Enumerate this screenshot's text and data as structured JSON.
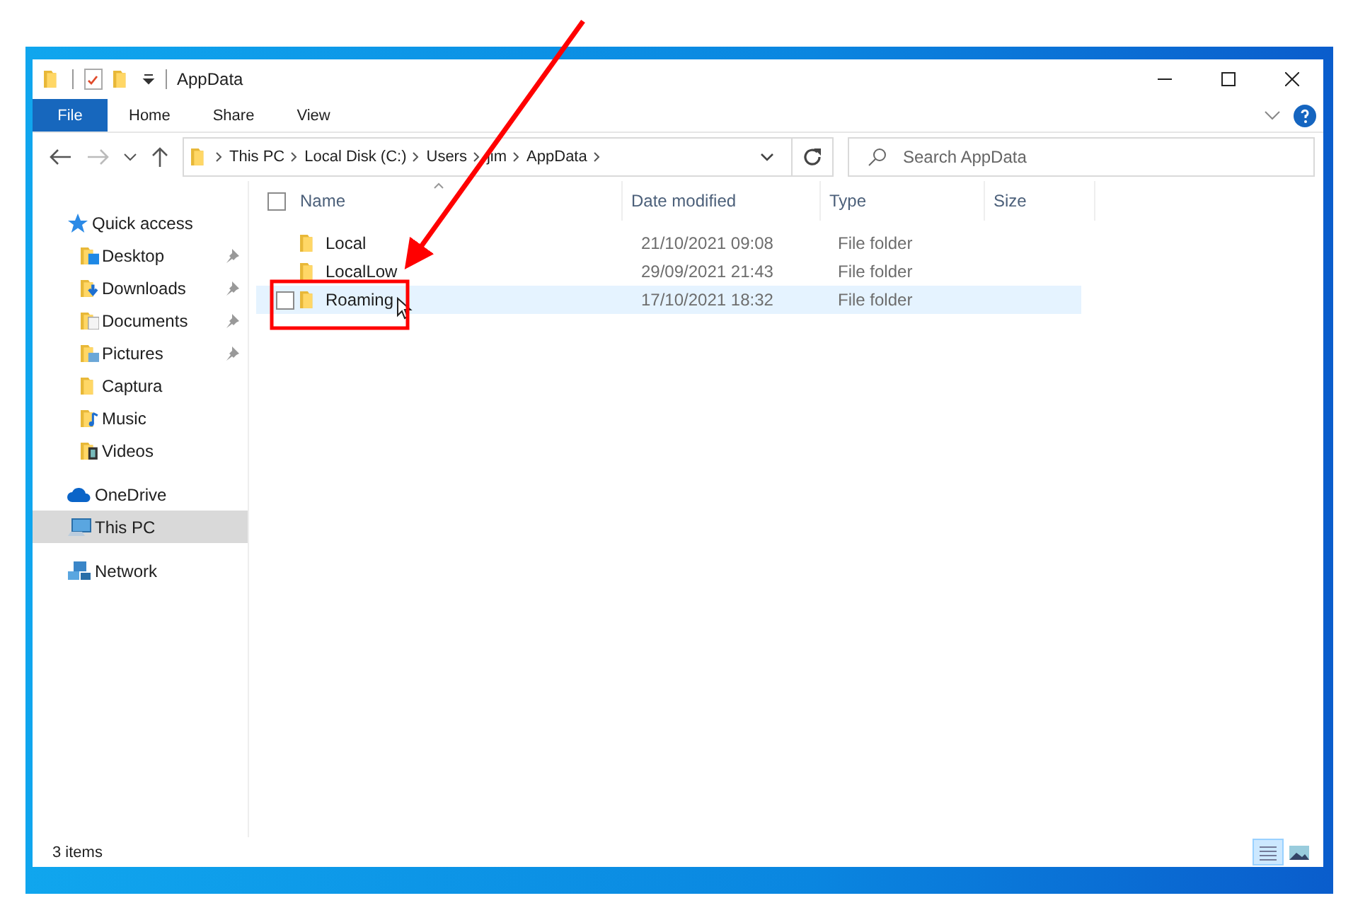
{
  "window": {
    "title": "AppData"
  },
  "ribbon_tabs": [
    {
      "label": "File",
      "kind": "file"
    },
    {
      "label": "Home",
      "kind": "tab"
    },
    {
      "label": "Share",
      "kind": "tab"
    },
    {
      "label": "View",
      "kind": "tab"
    }
  ],
  "address": {
    "path": [
      "This PC",
      "Local Disk (C:)",
      "Users",
      "jim",
      "AppData"
    ]
  },
  "search": {
    "placeholder": "Search AppData"
  },
  "nav": [
    {
      "label": "Quick access",
      "kind": "star",
      "selected": false,
      "children": [
        {
          "label": "Desktop",
          "kind": "desktop",
          "pinned": true,
          "selected": false
        },
        {
          "label": "Downloads",
          "kind": "downloads",
          "pinned": true,
          "selected": false
        },
        {
          "label": "Documents",
          "kind": "documents",
          "pinned": true,
          "selected": false
        },
        {
          "label": "Pictures",
          "kind": "pictures",
          "pinned": true,
          "selected": false
        },
        {
          "label": "Captura",
          "kind": "folder",
          "pinned": false,
          "selected": false
        },
        {
          "label": "Music",
          "kind": "music",
          "pinned": false,
          "selected": false
        },
        {
          "label": "Videos",
          "kind": "videos",
          "pinned": false,
          "selected": false
        }
      ]
    },
    {
      "label": "OneDrive",
      "kind": "cloud",
      "selected": false
    },
    {
      "label": "This PC",
      "kind": "pc",
      "selected": true
    },
    {
      "label": "Network",
      "kind": "network",
      "selected": false
    }
  ],
  "select_all": {
    "checked": false
  },
  "columns": [
    {
      "label": "Name",
      "sorted": true
    },
    {
      "label": "Date modified",
      "sorted": false
    },
    {
      "label": "Type",
      "sorted": false
    },
    {
      "label": "Size",
      "sorted": false
    }
  ],
  "rows": [
    {
      "name": "Local",
      "date": "21/10/2021 09:08",
      "type": "File folder",
      "hovered": false,
      "checked": false,
      "annotated": false
    },
    {
      "name": "LocalLow",
      "date": "29/09/2021 21:43",
      "type": "File folder",
      "hovered": false,
      "checked": false,
      "annotated": false
    },
    {
      "name": "Roaming",
      "date": "17/10/2021 18:32",
      "type": "File folder",
      "hovered": true,
      "checked": false,
      "annotated": true
    }
  ],
  "status_bar": {
    "item_count": "3 items"
  },
  "view_buttons": [
    {
      "kind": "details",
      "selected": true
    },
    {
      "kind": "thumbnails",
      "selected": false
    }
  ]
}
